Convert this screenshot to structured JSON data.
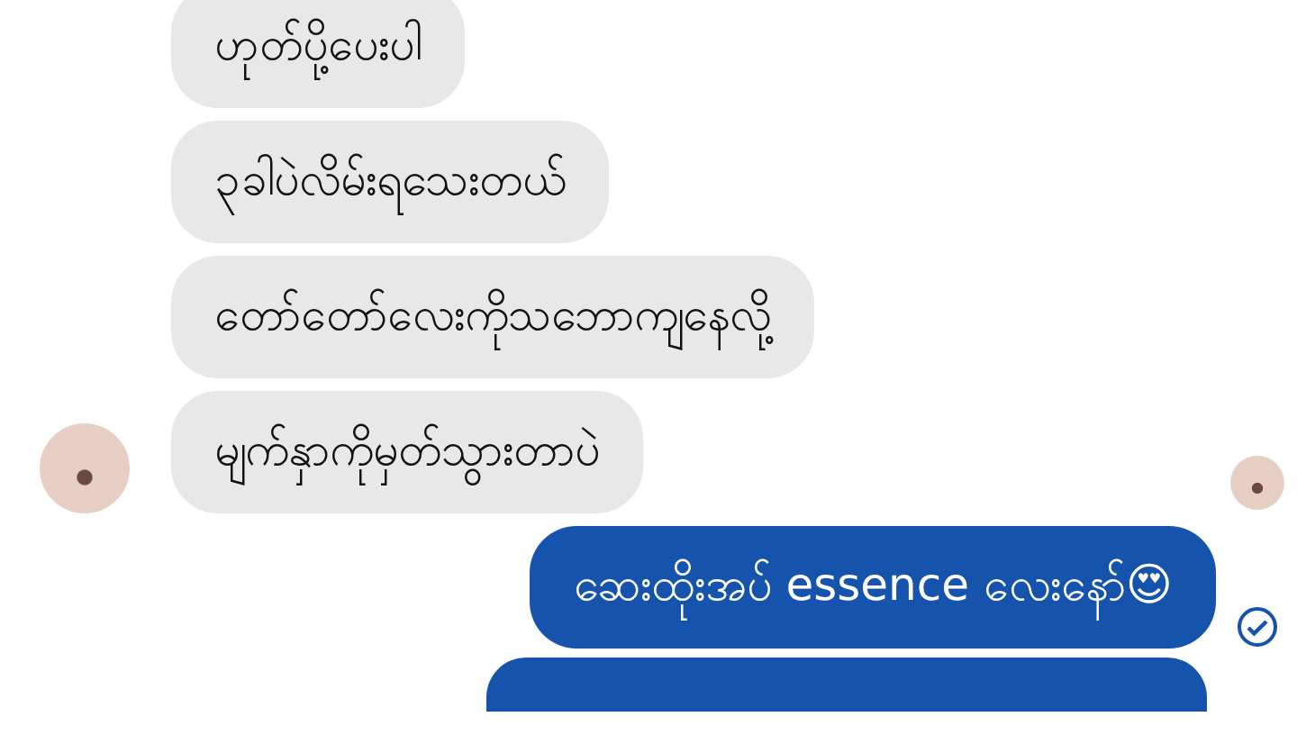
{
  "messages": [
    {
      "kind": "received",
      "text": "ဟုတ်ပို့ပေးပါ",
      "avatar": false,
      "seen": false,
      "sent": false
    },
    {
      "kind": "received",
      "text": "၃ခါပဲလိမ်းရသေးတယ်",
      "avatar": false,
      "seen": false,
      "sent": false
    },
    {
      "kind": "received",
      "text": "တော်တော်လေးကိုသဘောကျနေလို့",
      "avatar": false,
      "seen": false,
      "sent": false
    },
    {
      "kind": "received",
      "text": "မျက်နှာကိုမှတ်သွားတာပဲ",
      "avatar": true,
      "seen": true,
      "sent": false
    },
    {
      "kind": "sent",
      "text": "ဆေးထိုးအပ် essence လေးနော်😍",
      "avatar": false,
      "seen": false,
      "sent": true
    }
  ]
}
